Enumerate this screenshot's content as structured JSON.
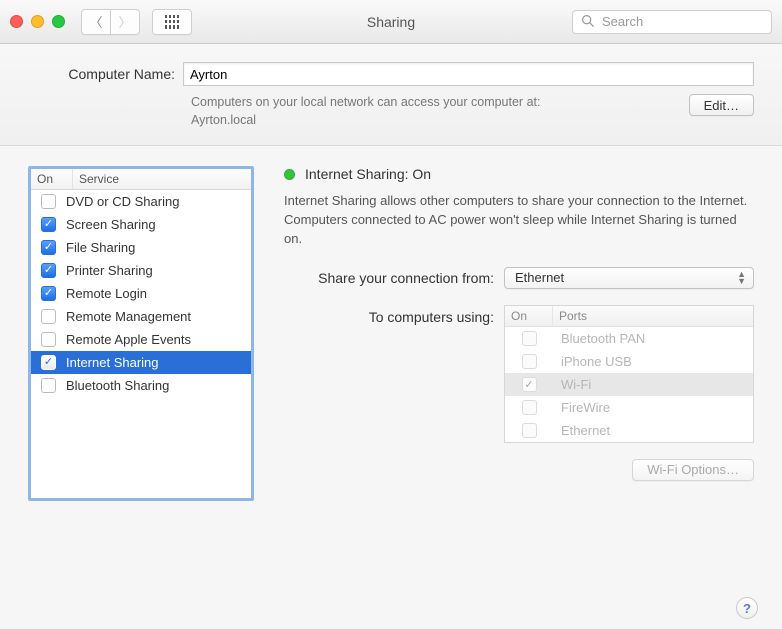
{
  "window": {
    "title": "Sharing",
    "search_placeholder": "Search"
  },
  "computer": {
    "label": "Computer Name:",
    "value": "Ayrton",
    "hint_line1": "Computers on your local network can access your computer at:",
    "hint_line2": "Ayrton.local",
    "edit_label": "Edit…"
  },
  "services": {
    "header_on": "On",
    "header_service": "Service",
    "items": [
      {
        "label": "DVD or CD Sharing",
        "checked": false,
        "selected": false
      },
      {
        "label": "Screen Sharing",
        "checked": true,
        "selected": false
      },
      {
        "label": "File Sharing",
        "checked": true,
        "selected": false
      },
      {
        "label": "Printer Sharing",
        "checked": true,
        "selected": false
      },
      {
        "label": "Remote Login",
        "checked": true,
        "selected": false
      },
      {
        "label": "Remote Management",
        "checked": false,
        "selected": false
      },
      {
        "label": "Remote Apple Events",
        "checked": false,
        "selected": false
      },
      {
        "label": "Internet Sharing",
        "checked": true,
        "selected": true
      },
      {
        "label": "Bluetooth Sharing",
        "checked": false,
        "selected": false
      }
    ]
  },
  "detail": {
    "status_title": "Internet Sharing: On",
    "status_color": "#35c23c",
    "description": "Internet Sharing allows other computers to share your connection to the Internet. Computers connected to AC power won't sleep while Internet Sharing is turned on.",
    "share_from_label": "Share your connection from:",
    "share_from_value": "Ethernet",
    "to_label": "To computers using:",
    "ports_header_on": "On",
    "ports_header_ports": "Ports",
    "ports": [
      {
        "label": "Bluetooth PAN",
        "checked": false,
        "selected": false
      },
      {
        "label": "iPhone USB",
        "checked": false,
        "selected": false
      },
      {
        "label": "Wi-Fi",
        "checked": true,
        "selected": true
      },
      {
        "label": "FireWire",
        "checked": false,
        "selected": false
      },
      {
        "label": "Ethernet",
        "checked": false,
        "selected": false
      }
    ],
    "wifi_options_label": "Wi-Fi Options…"
  },
  "help_label": "?"
}
